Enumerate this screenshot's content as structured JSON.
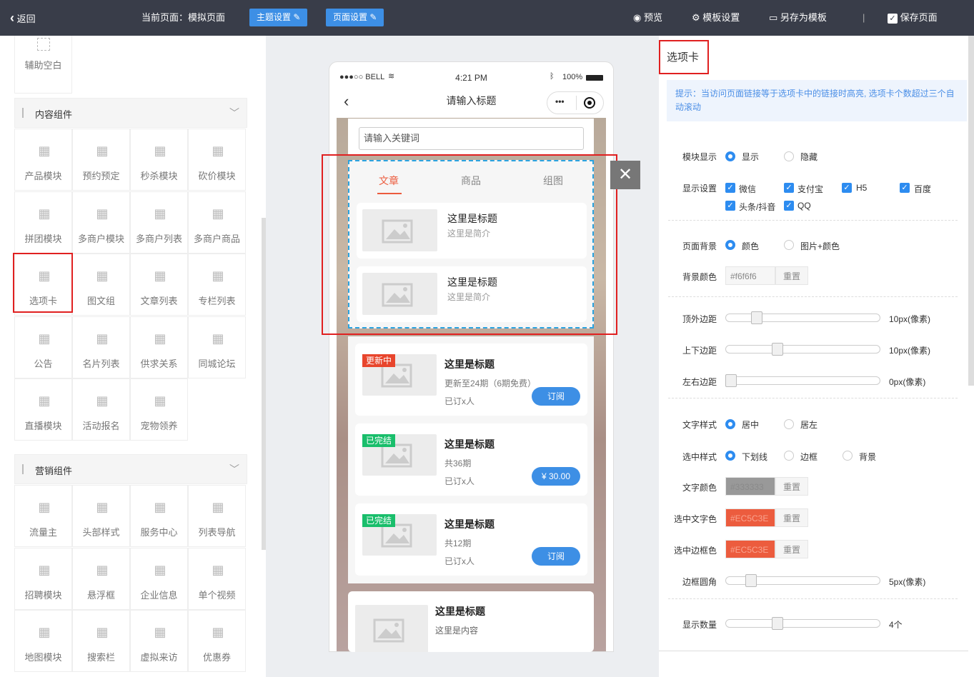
{
  "topbar": {
    "back_label": "返回",
    "current_page": "当前页面：模拟页面",
    "theme_settings": "主题设置",
    "page_settings": "页面设置",
    "preview": "预览",
    "template_settings": "模板设置",
    "save_as_template": "另存为模板",
    "save_page": "保存页面"
  },
  "left": {
    "aux_blank": "辅助空白",
    "content_section": "内容组件",
    "content_items": [
      "产品模块",
      "预约预定",
      "秒杀模块",
      "砍价模块",
      "拼团模块",
      "多商户模块",
      "多商户列表",
      "多商户商品",
      "选项卡",
      "图文组",
      "文章列表",
      "专栏列表",
      "公告",
      "名片列表",
      "供求关系",
      "同城论坛",
      "直播模块",
      "活动报名",
      "宠物领养"
    ],
    "marketing_section": "营销组件",
    "marketing_items": [
      "流量主",
      "头部样式",
      "服务中心",
      "列表导航",
      "招聘模块",
      "悬浮框",
      "企业信息",
      "单个视频",
      "地图模块",
      "搜索栏",
      "虚拟来访",
      "优惠券"
    ]
  },
  "phone": {
    "carrier": "●●●○○ BELL",
    "time": "4:21 PM",
    "battery": "100%",
    "title": "请输入标题",
    "search_placeholder": "请输入关键词",
    "tabs": [
      "文章",
      "商品",
      "组图"
    ],
    "tab_items": [
      {
        "title": "这里是标题",
        "desc": "这里是简介"
      },
      {
        "title": "这里是标题",
        "desc": "这里是简介"
      }
    ],
    "courses": [
      {
        "badge": "更新中",
        "title": "这里是标题",
        "line1": "更新至24期（6期免费）",
        "line2": "已订x人",
        "action": "订阅"
      },
      {
        "badge": "已完结",
        "title": "这里是标题",
        "line1": "共36期",
        "line2": "已订x人",
        "action": "¥ 30.00"
      },
      {
        "badge": "已完结",
        "title": "这里是标题",
        "line1": "共12期",
        "line2": "已订x人",
        "action": "订阅"
      }
    ],
    "last_card": {
      "title": "这里是标题",
      "desc": "这里是内容"
    }
  },
  "right": {
    "title": "选项卡",
    "tip": "提示：当访问页面链接等于选项卡中的链接时高亮, 选项卡个数超过三个自动滚动",
    "module_display": "模块显示",
    "show": "显示",
    "hide": "隐藏",
    "display_settings": "显示设置",
    "platforms": [
      "微信",
      "支付宝",
      "H5",
      "百度",
      "头条/抖音",
      "QQ"
    ],
    "page_bg": "页面背景",
    "bg_color_opt": "颜色",
    "bg_image_opt": "图片+颜色",
    "bg_color_label": "背景颜色",
    "bg_color_value": "#f6f6f6",
    "reset": "重置",
    "top_margin": "顶外边距",
    "top_margin_value": "10px(像素)",
    "vertical_margin": "上下边距",
    "vertical_margin_value": "10px(像素)",
    "horizontal_margin": "左右边距",
    "horizontal_margin_value": "0px(像素)",
    "text_style": "文字样式",
    "center": "居中",
    "left": "居左",
    "selected_style": "选中样式",
    "underline": "下划线",
    "border": "边框",
    "background": "背景",
    "text_color": "文字颜色",
    "text_color_value": "#333333",
    "selected_text_color": "选中文字色",
    "selected_text_color_value": "#EC5C3E",
    "selected_border_color": "选中边框色",
    "selected_border_color_value": "#EC5C3E",
    "border_radius": "边框圆角",
    "border_radius_value": "5px(像素)",
    "display_count": "显示数量",
    "display_count_value": "4个"
  },
  "colors": {
    "topbar": "#393d49",
    "accent": "#2d8cf0",
    "tab_active": "#EC5C3E",
    "badge_updating": "#e8452c",
    "badge_done": "#19be6b",
    "highlight": "#e02020"
  }
}
